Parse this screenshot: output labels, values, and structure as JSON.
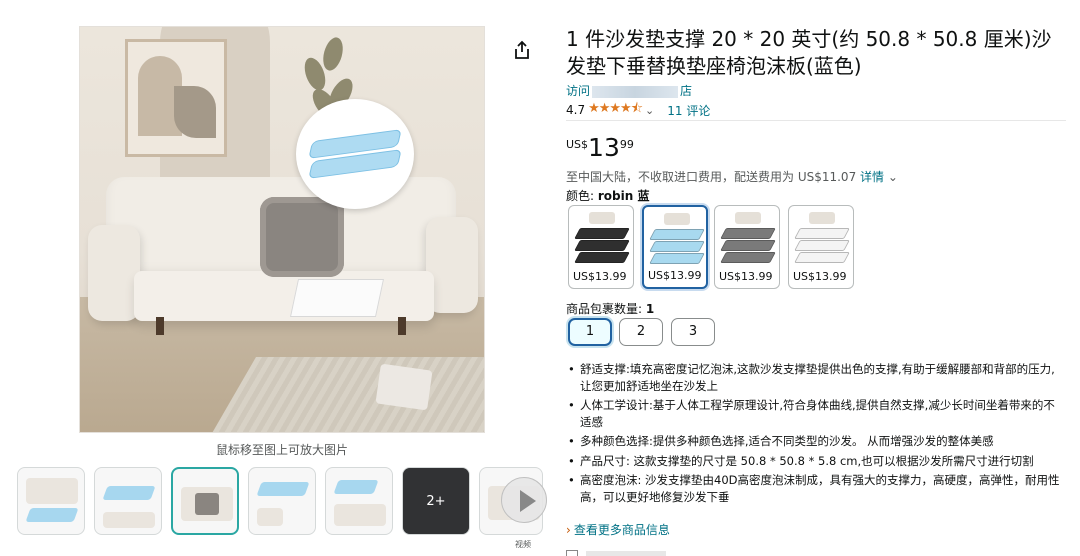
{
  "gallery": {
    "zoom_hint": "鼠标移至图上可放大图片",
    "more_thumbs_label": "2+",
    "video_label": "视频"
  },
  "product": {
    "title": "1 件沙发垫支撑 20 * 20 英寸(约 50.8 * 50.8 厘米)沙发垫下垂替换垫座椅泡沫板(蓝色)",
    "store_prefix": "访问",
    "store_suffix": "店",
    "rating_value": "4.7",
    "rating_stars": 4.5,
    "stars_glyph": "★★★★⯪",
    "chevron": "⌄",
    "reviews": "11 评论",
    "price_currency": "US$",
    "price_whole": "13",
    "price_fraction": "99",
    "shipping_text": "至中国大陆，不收取进口费用，配送费用为 US$11.07",
    "shipping_details": "详情",
    "shipping_chevron": "⌄",
    "color_label": "颜色: ",
    "color_value": "robin 蓝",
    "swatches": [
      {
        "price": "US$13.99",
        "color": "#2f2f2f"
      },
      {
        "price": "US$13.99",
        "color": "#a8d9ef"
      },
      {
        "price": "US$13.99",
        "color": "#7a7a7a"
      },
      {
        "price": "US$13.99",
        "color": "#f4f4f4"
      }
    ],
    "qty_label": "商品包裹数量: ",
    "qty_value": "1",
    "qty_options": [
      "1",
      "2",
      "3"
    ],
    "bullets": [
      "舒适支撑:填充高密度记忆泡沫,这款沙发支撑垫提供出色的支撑,有助于缓解腰部和背部的压力,让您更加舒适地坐在沙发上",
      "人体工学设计:基于人体工程学原理设计,符合身体曲线,提供自然支撑,减少长时间坐着带来的不适感",
      "多种颜色选择:提供多种颜色选择,适合不同类型的沙发。 从而增强沙发的整体美感",
      "产品尺寸: 这款支撑垫的尺寸是 50.8 * 50.8 * 5.8 cm,也可以根据沙发所需尺寸进行切割",
      "高密度泡沫: 沙发支撑垫由40D高密度泡沫制成，具有强大的支撑力，高硬度，高弹性，耐用性高，可以更好地修复沙发下垂"
    ],
    "see_more_arrow": "›",
    "see_more": "查看更多商品信息"
  },
  "colors": {
    "link": "#007185",
    "star": "#de7921",
    "selected_border": "#2162a1",
    "thumb_selected": "#2aa7a3"
  }
}
